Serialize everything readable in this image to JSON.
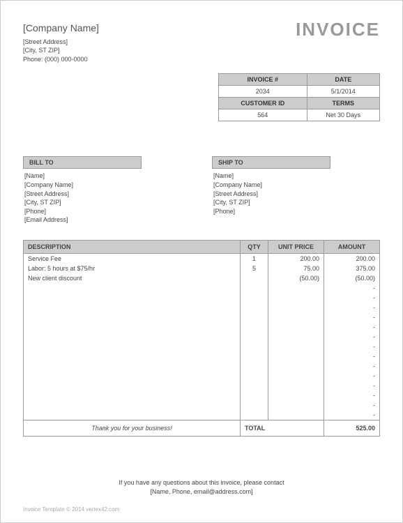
{
  "company": {
    "name": "[Company Name]",
    "street": "[Street Address]",
    "city": "[City, ST  ZIP]",
    "phone": "Phone: (000) 000-0000"
  },
  "title": "INVOICE",
  "meta": {
    "invoice_label": "INVOICE #",
    "invoice_value": "2034",
    "date_label": "DATE",
    "date_value": "5/1/2014",
    "customer_label": "CUSTOMER ID",
    "customer_value": "564",
    "terms_label": "TERMS",
    "terms_value": "Net 30 Days"
  },
  "bill_to": {
    "header": "BILL TO",
    "name": "[Name]",
    "company": "[Company Name]",
    "street": "[Street Address]",
    "city": "[City, ST  ZIP]",
    "phone": "[Phone]",
    "email": "[Email Address]"
  },
  "ship_to": {
    "header": "SHIP TO",
    "name": "[Name]",
    "company": "[Company Name]",
    "street": "[Street Address]",
    "city": "[City, ST  ZIP]",
    "phone": "[Phone]"
  },
  "columns": {
    "description": "DESCRIPTION",
    "qty": "QTY",
    "unit_price": "UNIT PRICE",
    "amount": "AMOUNT"
  },
  "lines": [
    {
      "description": "Service Fee",
      "qty": "1",
      "unit_price": "200.00",
      "amount": "200.00"
    },
    {
      "description": "Labor: 5 hours at $75/hr",
      "qty": "5",
      "unit_price": "75.00",
      "amount": "375.00"
    },
    {
      "description": "New client discount",
      "qty": "",
      "unit_price": "(50.00)",
      "amount": "(50.00)"
    },
    {
      "description": "",
      "qty": "",
      "unit_price": "",
      "amount": "-"
    },
    {
      "description": "",
      "qty": "",
      "unit_price": "",
      "amount": "-"
    },
    {
      "description": "",
      "qty": "",
      "unit_price": "",
      "amount": "-"
    },
    {
      "description": "",
      "qty": "",
      "unit_price": "",
      "amount": "-"
    },
    {
      "description": "",
      "qty": "",
      "unit_price": "",
      "amount": "-"
    },
    {
      "description": "",
      "qty": "",
      "unit_price": "",
      "amount": "-"
    },
    {
      "description": "",
      "qty": "",
      "unit_price": "",
      "amount": "-"
    },
    {
      "description": "",
      "qty": "",
      "unit_price": "",
      "amount": "-"
    },
    {
      "description": "",
      "qty": "",
      "unit_price": "",
      "amount": "-"
    },
    {
      "description": "",
      "qty": "",
      "unit_price": "",
      "amount": "-"
    },
    {
      "description": "",
      "qty": "",
      "unit_price": "",
      "amount": "-"
    },
    {
      "description": "",
      "qty": "",
      "unit_price": "",
      "amount": "-"
    },
    {
      "description": "",
      "qty": "",
      "unit_price": "",
      "amount": "-"
    },
    {
      "description": "",
      "qty": "",
      "unit_price": "",
      "amount": "-"
    }
  ],
  "thank_you": "Thank you for your business!",
  "total_label": "TOTAL",
  "total_value": "525.00",
  "footer": {
    "line1": "If you have any questions about this invoice, please contact",
    "line2": "[Name, Phone, email@address.com]"
  },
  "copyright": "Invoice Template © 2014 vertex42.com"
}
